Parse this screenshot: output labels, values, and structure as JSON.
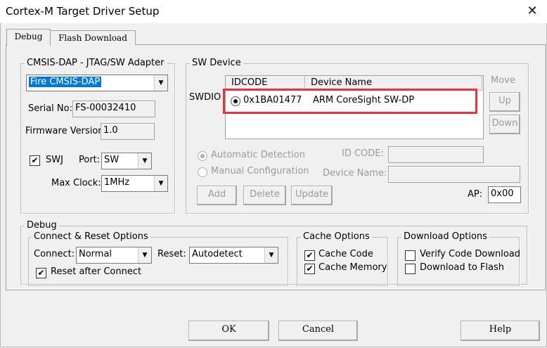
{
  "window": {
    "title": "Cortex-M Target Driver Setup",
    "close_glyph": "✕"
  },
  "tabs": [
    {
      "label": "Debug"
    },
    {
      "label": "Flash Download"
    }
  ],
  "adapter": {
    "legend": "CMSIS-DAP - JTAG/SW Adapter",
    "selected": "Fire CMSIS-DAP",
    "serial_label": "Serial No:",
    "serial_value": "FS-00032410",
    "firmware_label": "Firmware Version:",
    "firmware_value": "1.0",
    "swj_label": "SWJ",
    "swj_checked": true,
    "port_label": "Port:",
    "port_value": "SW",
    "clock_label": "Max Clock:",
    "clock_value": "1MHz"
  },
  "sw_device": {
    "legend": "SW Device",
    "side_label": "SWDIO",
    "columns": [
      "IDCODE",
      "Device Name"
    ],
    "rows": [
      {
        "idcode": "0x1BA01477",
        "name": "ARM CoreSight SW-DP"
      }
    ],
    "move_label": "Move",
    "up_label": "Up",
    "down_label": "Down",
    "auto_label": "Automatic Detection",
    "manual_label": "Manual Configuration",
    "idcode_label": "ID CODE:",
    "devname_label": "Device Name:",
    "add_label": "Add",
    "delete_label": "Delete",
    "update_label": "Update",
    "ap_label": "AP:",
    "ap_value": "0x00",
    "highlight_color": "#e8333a"
  },
  "debug": {
    "legend": "Debug",
    "connect_group": "Connect & Reset Options",
    "connect_label": "Connect:",
    "connect_value": "Normal",
    "reset_label": "Reset:",
    "reset_value": "Autodetect",
    "reset_after_label": "Reset after Connect",
    "reset_after_checked": true,
    "cache_group": "Cache Options",
    "cache_code_label": "Cache Code",
    "cache_memory_label": "Cache Memory",
    "download_group": "Download Options",
    "verify_label": "Verify Code Download",
    "download_flash_label": "Download to Flash"
  },
  "footer": {
    "ok_label": "OK",
    "cancel_label": "Cancel",
    "help_label": "Help"
  },
  "glyphs": {
    "check": "✔",
    "down_arrow": "▼"
  }
}
